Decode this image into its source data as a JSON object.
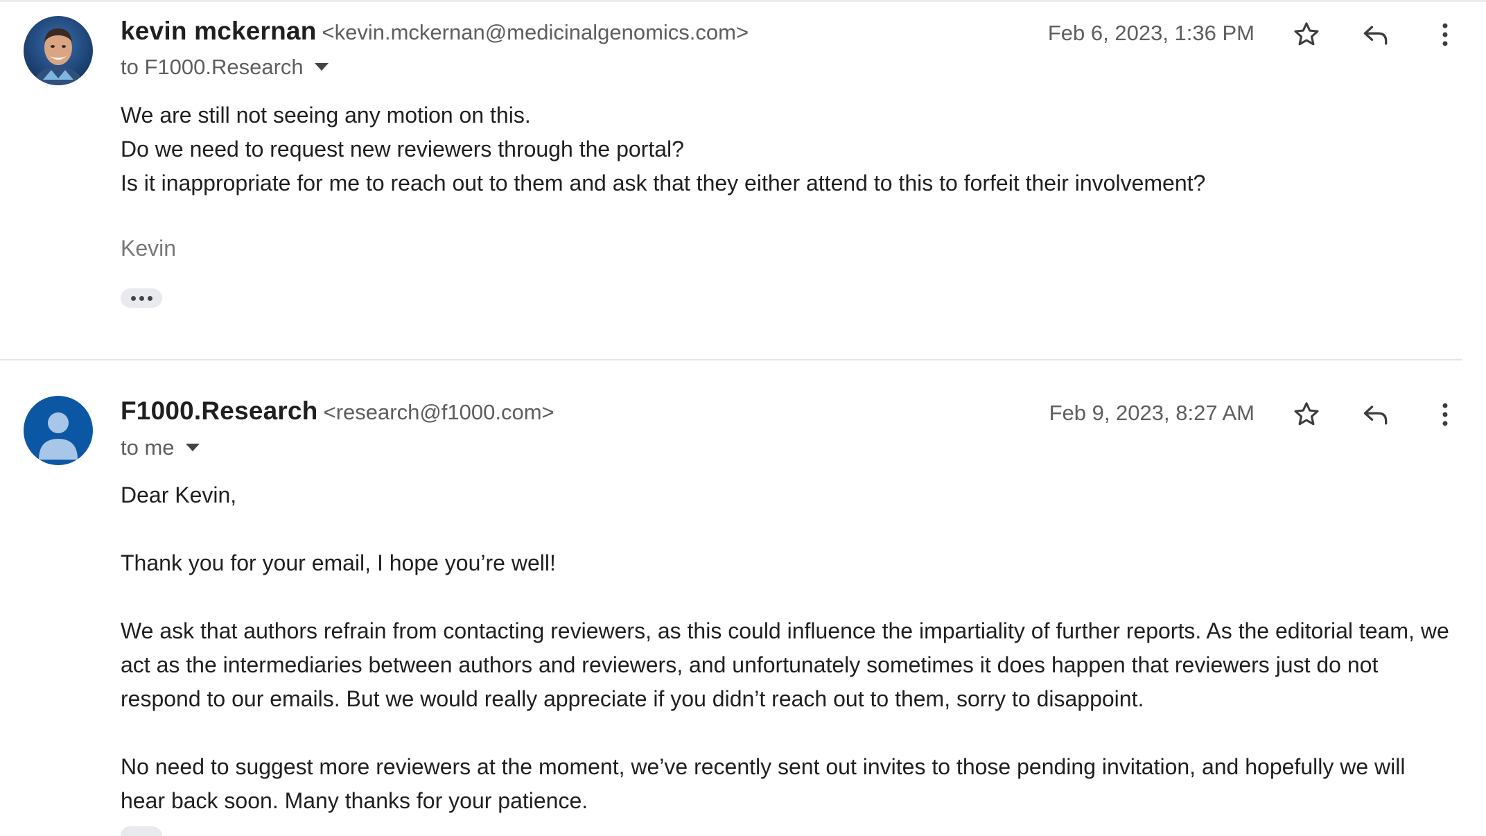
{
  "messages": [
    {
      "sender_name": "kevin mckernan",
      "sender_email": "<kevin.mckernan@medicinalgenomics.com>",
      "to": "to F1000.Research",
      "date": "Feb 6, 2023, 1:36 PM",
      "body": [
        "We are still not seeing any motion on this.",
        "Do we need to request new reviewers through the portal?",
        "Is it inappropriate for me to reach out to them and ask that they either attend to this to forfeit their involvement?"
      ],
      "signature": "Kevin",
      "avatar_icon": "photo-avatar-icon"
    },
    {
      "sender_name": "F1000.Research",
      "sender_email": "<research@f1000.com>",
      "to": "to me",
      "date": "Feb 9, 2023, 8:27 AM",
      "body": [
        "Dear Kevin,",
        "Thank you for your email, I hope you’re well!",
        "We ask that authors refrain from contacting reviewers, as this could influence the impartiality of further reports. As the editorial team, we act as the intermediaries between authors and reviewers, and unfortunately sometimes it does happen that reviewers just do not respond to our emails. But we would really appreciate if you didn’t reach out to them, sorry to disappoint.",
        "No need to suggest more reviewers at the moment, we’ve recently sent out invites to those pending invitation, and hopefully we will hear back soon. Many thanks for your patience."
      ],
      "avatar_icon": "default-person-avatar-icon"
    }
  ],
  "icons": {
    "star": "star-icon",
    "reply": "reply-icon",
    "more": "more-vert-icon",
    "recipients_toggle": "caret-down-icon",
    "trimmed_content": "ellipsis-icon"
  },
  "colors": {
    "default_avatar_bg": "#0b57a4",
    "default_avatar_figure": "#a8c7e8"
  }
}
